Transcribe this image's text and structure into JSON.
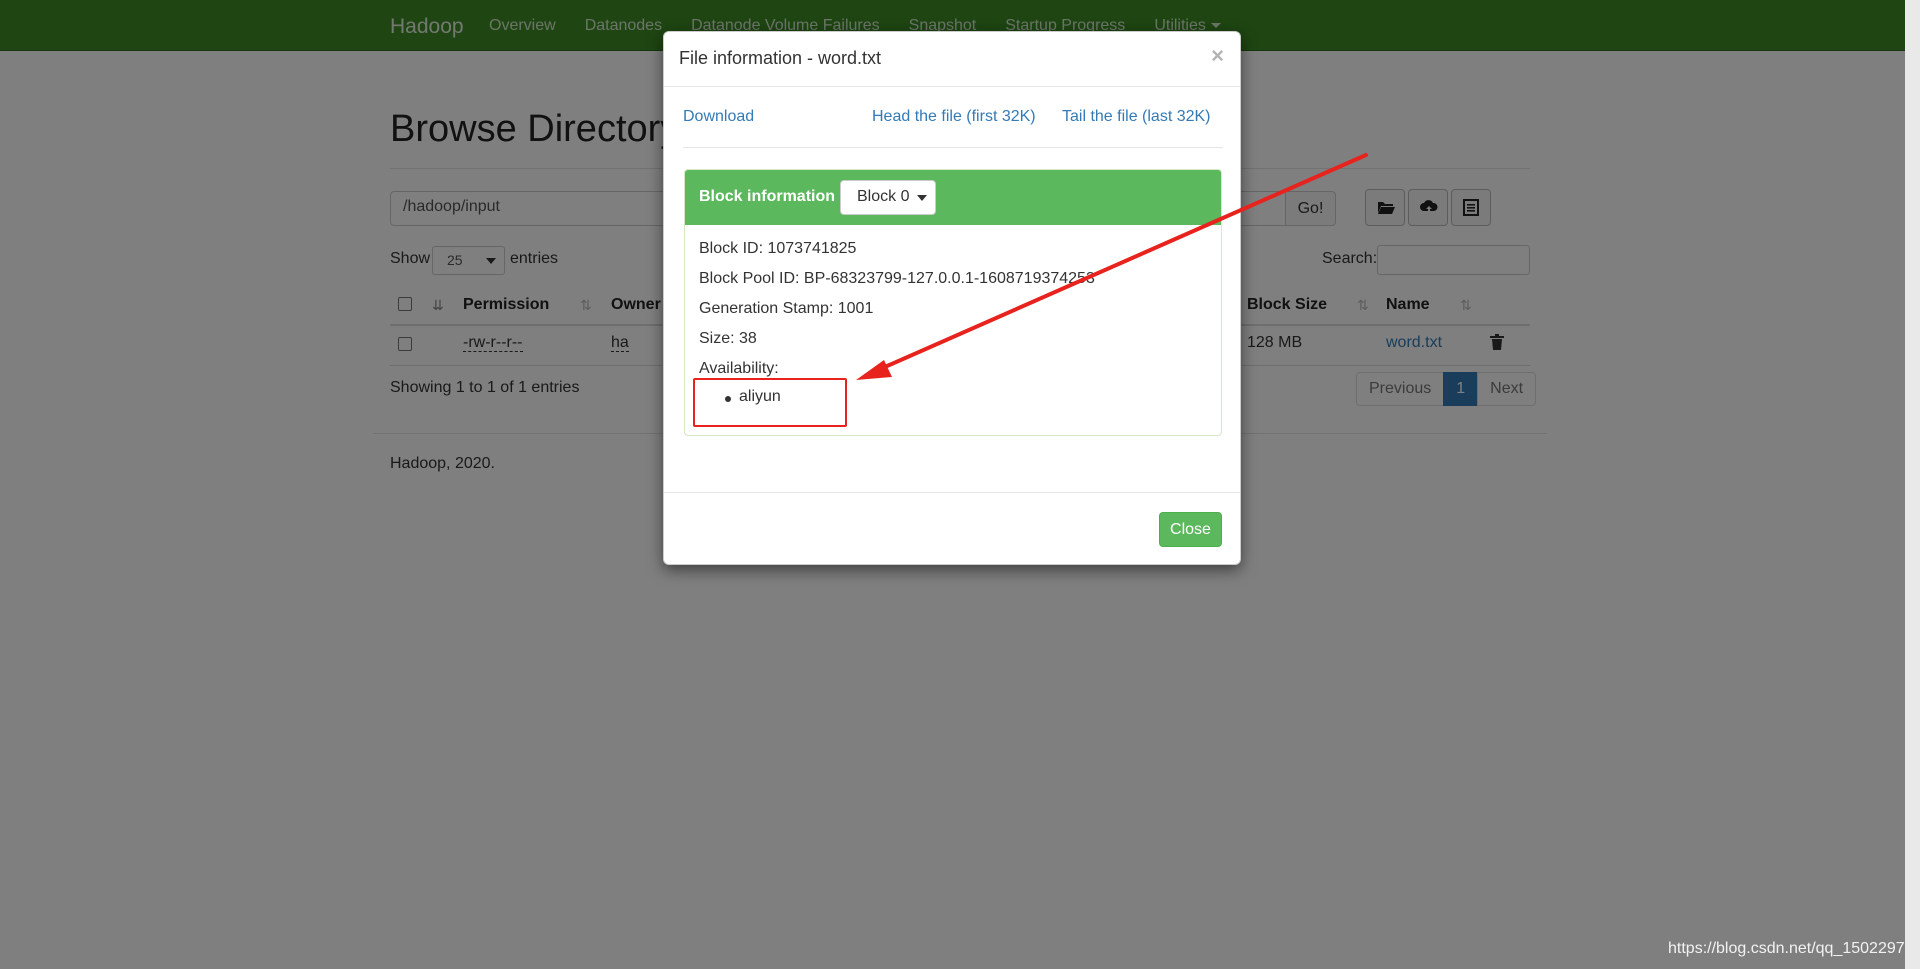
{
  "navbar": {
    "brand": "Hadoop",
    "items": [
      "Overview",
      "Datanodes",
      "Datanode Volume Failures",
      "Snapshot",
      "Startup Progress",
      "Utilities"
    ]
  },
  "browser": {
    "title": "Browse Directory",
    "path": "/hadoop/input",
    "go_label": "Go!",
    "show_label": "Show",
    "page_size": "25",
    "entries_label": "entries",
    "search_label": "Search:",
    "columns": [
      "Permission",
      "Owner",
      "Block Size",
      "Name"
    ],
    "row": {
      "permission": "-rw-r--r--",
      "owner": "ha",
      "block_size": "128 MB",
      "name": "word.txt"
    },
    "showing_text": "Showing 1 to 1 of 1 entries",
    "pager": {
      "previous": "Previous",
      "page": "1",
      "next": "Next"
    },
    "footer": "Hadoop, 2020."
  },
  "modal": {
    "title": "File information - word.txt",
    "close_x": "×",
    "links": {
      "download": "Download",
      "head": "Head the file (first 32K)",
      "tail": "Tail the file (last 32K)"
    },
    "block_heading": "Block information --",
    "block_selected": "Block 0",
    "details": {
      "block_id": "Block ID: 1073741825",
      "block_pool_id": "Block Pool ID: BP-68323799-127.0.0.1-1608719374253",
      "generation_stamp": "Generation Stamp: 1001",
      "size": "Size: 38",
      "availability_label": "Availability:"
    },
    "availability": [
      "aliyun"
    ],
    "close_button": "Close"
  },
  "annotation": {
    "color": "#e8221c"
  },
  "watermark": "https://blog.csdn.net/qq_1502297",
  "colors": {
    "navbar": "#3d8b25",
    "panel_heading": "#5cb85c",
    "link": "#337ab7",
    "pager_active": "#337ab7"
  }
}
